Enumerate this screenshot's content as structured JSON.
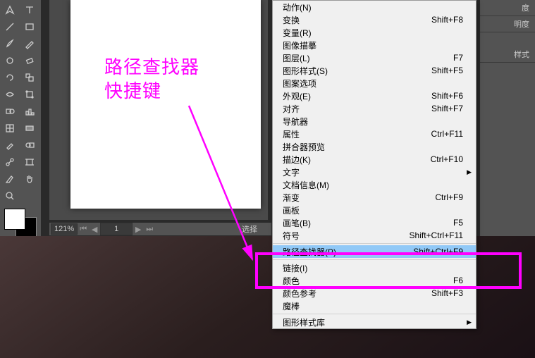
{
  "annotation": {
    "line1": "路径查找器",
    "line2": "快捷键"
  },
  "status": {
    "zoom": "121%",
    "page": "1",
    "sel": "选择"
  },
  "panels": {
    "items": [
      "度",
      "明度",
      "样式"
    ]
  },
  "menu": [
    {
      "label": "动作(N)",
      "shortcut": ""
    },
    {
      "label": "变换",
      "shortcut": "Shift+F8"
    },
    {
      "label": "变量(R)",
      "shortcut": ""
    },
    {
      "label": "图像描摹",
      "shortcut": ""
    },
    {
      "label": "图层(L)",
      "shortcut": "F7"
    },
    {
      "label": "图形样式(S)",
      "shortcut": "Shift+F5"
    },
    {
      "label": "图案选项",
      "shortcut": ""
    },
    {
      "label": "外观(E)",
      "shortcut": "Shift+F6"
    },
    {
      "label": "对齐",
      "shortcut": "Shift+F7"
    },
    {
      "label": "导航器",
      "shortcut": ""
    },
    {
      "label": "属性",
      "shortcut": "Ctrl+F11"
    },
    {
      "label": "拼合器预览",
      "shortcut": ""
    },
    {
      "label": "描边(K)",
      "shortcut": "Ctrl+F10"
    },
    {
      "label": "文字",
      "shortcut": "",
      "sub": true
    },
    {
      "label": "文档信息(M)",
      "shortcut": ""
    },
    {
      "label": "渐变",
      "shortcut": "Ctrl+F9"
    },
    {
      "label": "画板",
      "shortcut": ""
    },
    {
      "label": "画笔(B)",
      "shortcut": "F5"
    },
    {
      "label": "符号",
      "shortcut": "Shift+Ctrl+F11"
    },
    {
      "sep": true
    },
    {
      "label": "路径查找器(P)",
      "shortcut": "Shift+Ctrl+F9",
      "hover": true
    },
    {
      "sep": true
    },
    {
      "label": "链接(I)",
      "shortcut": ""
    },
    {
      "label": "颜色",
      "shortcut": "F6"
    },
    {
      "label": "颜色参考",
      "shortcut": "Shift+F3"
    },
    {
      "label": "魔棒",
      "shortcut": ""
    },
    {
      "sep": true
    },
    {
      "label": "图形样式库",
      "shortcut": "",
      "sub": true
    }
  ]
}
